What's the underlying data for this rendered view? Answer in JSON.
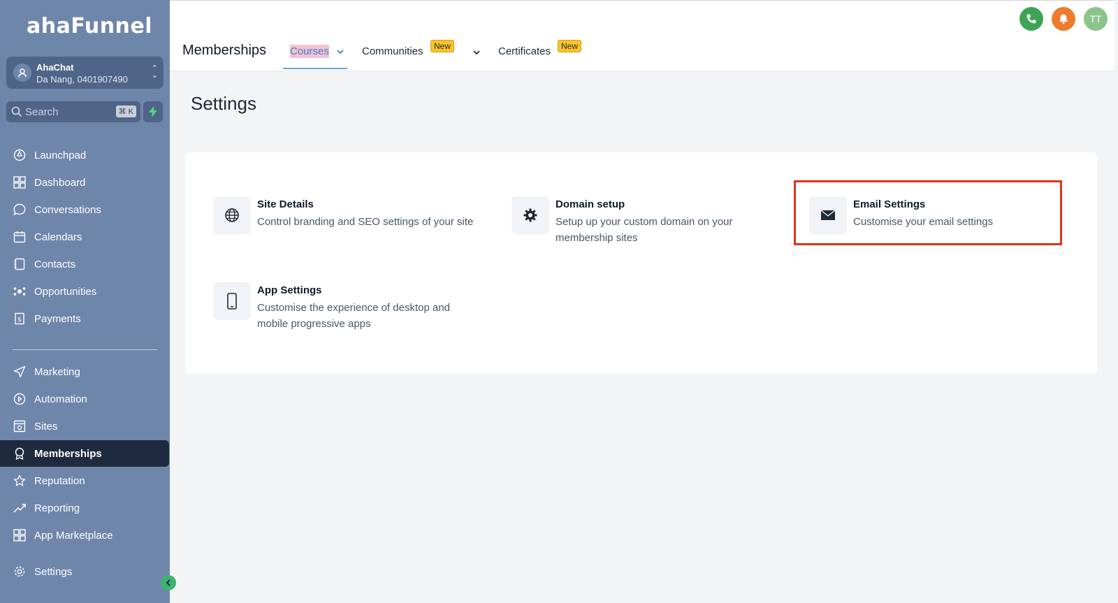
{
  "brand": {
    "logo": "ahaFunnel"
  },
  "account": {
    "name": "AhaChat",
    "location": "Da Nang, 0401907490"
  },
  "search": {
    "placeholder": "Search",
    "shortcut": "⌘ K"
  },
  "sidebar": {
    "items": [
      {
        "label": "Launchpad",
        "icon": "rocket-icon"
      },
      {
        "label": "Dashboard",
        "icon": "grid-icon"
      },
      {
        "label": "Conversations",
        "icon": "chat-icon"
      },
      {
        "label": "Calendars",
        "icon": "calendar-icon"
      },
      {
        "label": "Contacts",
        "icon": "contacts-icon"
      },
      {
        "label": "Opportunities",
        "icon": "opportunities-icon"
      },
      {
        "label": "Payments",
        "icon": "receipt-icon"
      },
      {
        "label": "Marketing",
        "icon": "send-icon"
      },
      {
        "label": "Automation",
        "icon": "automation-icon"
      },
      {
        "label": "Sites",
        "icon": "sites-icon"
      },
      {
        "label": "Memberships",
        "icon": "badge-icon",
        "active": true
      },
      {
        "label": "Reputation",
        "icon": "star-icon"
      },
      {
        "label": "Reporting",
        "icon": "trend-icon"
      },
      {
        "label": "App Marketplace",
        "icon": "apps-icon"
      },
      {
        "label": "Settings",
        "icon": "gear-icon"
      }
    ]
  },
  "header": {
    "module": "Memberships",
    "tabs": [
      {
        "label": "Courses",
        "active": true
      },
      {
        "label": "Communities",
        "badge": "New"
      },
      {
        "label": "Certificates",
        "badge": "New"
      }
    ],
    "avatar_initials": "TT"
  },
  "page": {
    "title": "Settings",
    "items": [
      {
        "title": "Site Details",
        "description": "Control branding and SEO settings of your site",
        "icon": "globe-icon"
      },
      {
        "title": "Domain setup",
        "description": "Setup up your custom domain on your membership sites",
        "icon": "gear-icon"
      },
      {
        "title": "Email Settings",
        "description": "Customise your email settings",
        "icon": "envelope-icon"
      },
      {
        "title": "App Settings",
        "description": "Customise the experience of desktop and mobile progressive apps",
        "icon": "phone-icon"
      }
    ]
  },
  "colors": {
    "sidebar": "#6f86ab",
    "active": "#1e2a3d",
    "accent": "#3b82c4",
    "highlight": "#e0331a",
    "badge": "#f8c42a"
  }
}
